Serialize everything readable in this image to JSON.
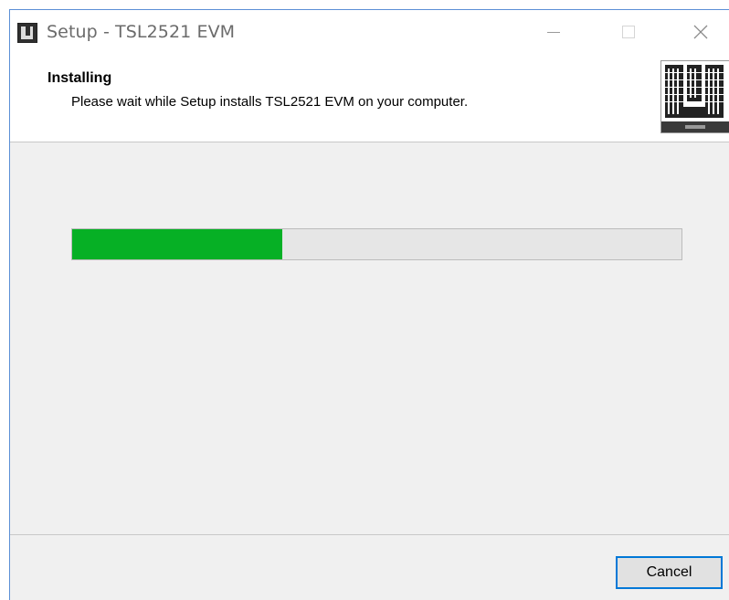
{
  "window": {
    "title": "Setup - TSL2521 EVM",
    "app_icon": "setup-logo-icon"
  },
  "header": {
    "title": "Installing",
    "subtitle": "Please wait while Setup installs TSL2521 EVM on your computer."
  },
  "progress": {
    "percent": 34.5,
    "fill_color": "#06b025"
  },
  "buttons": {
    "cancel_label": "Cancel"
  }
}
